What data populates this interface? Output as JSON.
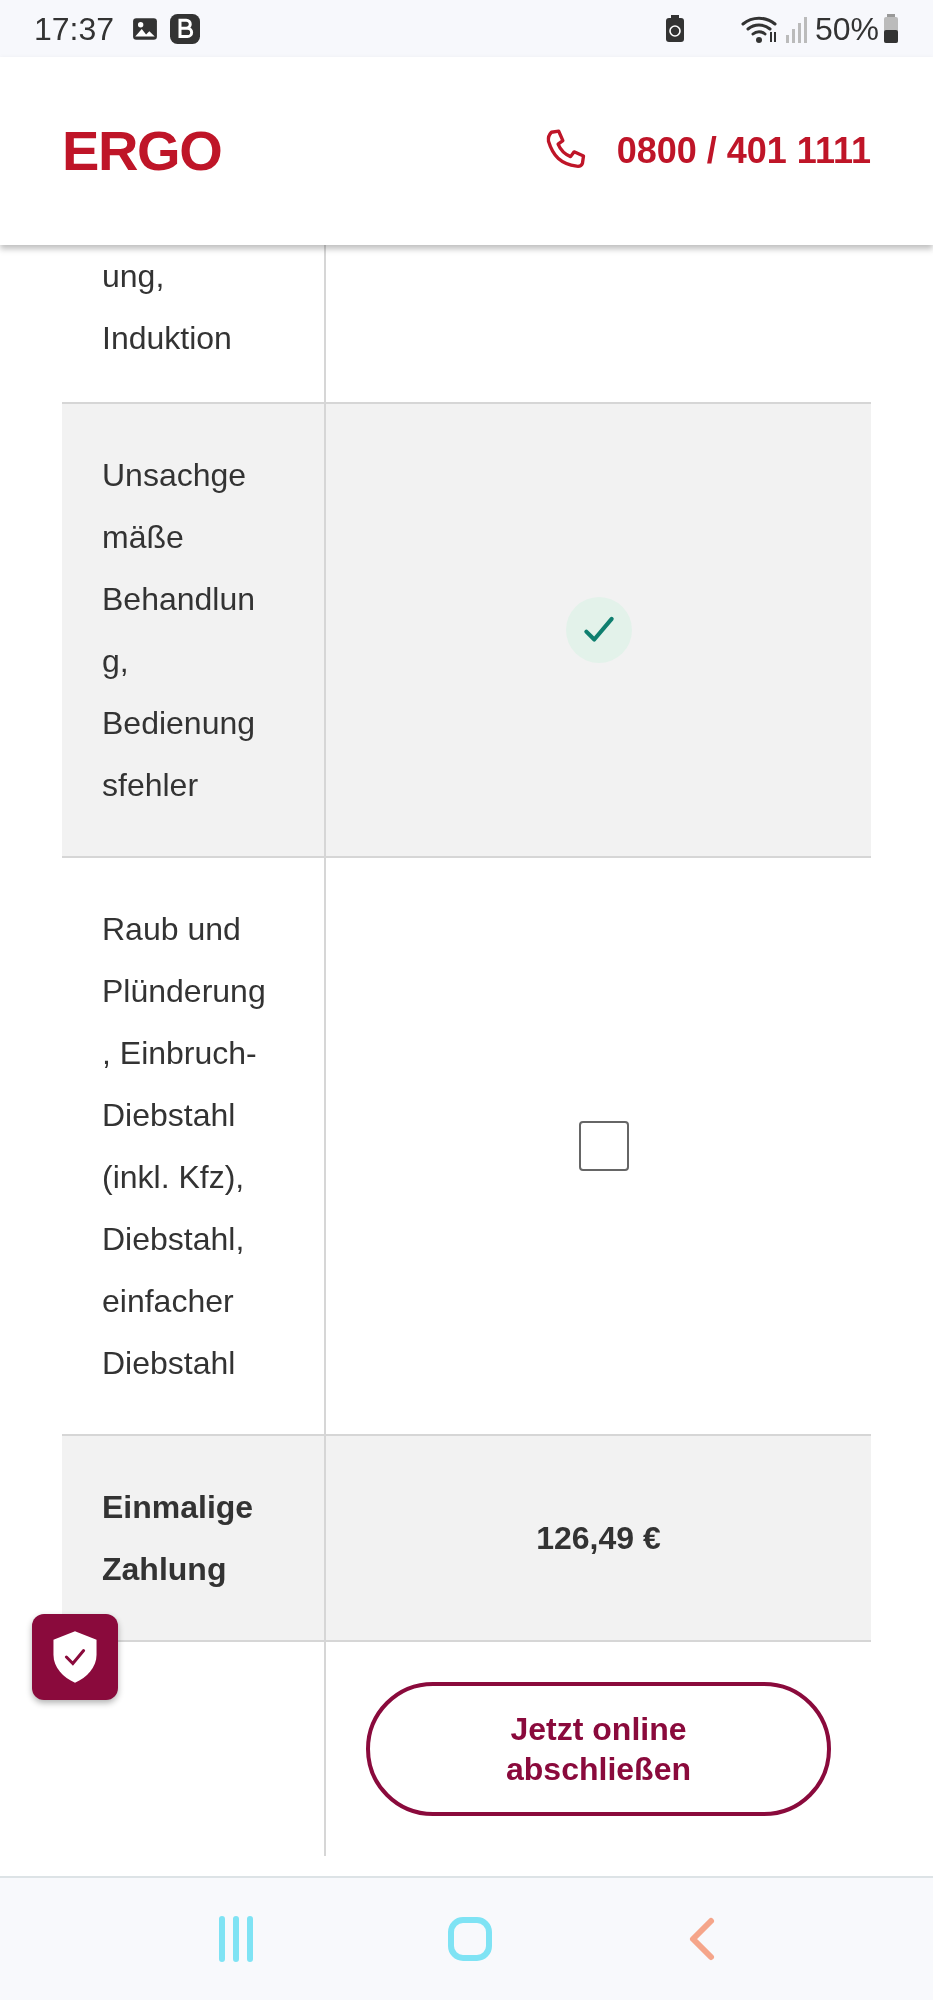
{
  "status_bar": {
    "time": "17:37",
    "battery": "50%"
  },
  "header": {
    "logo": "ERGO",
    "phone": "0800 / 401 1111"
  },
  "table": {
    "rows": [
      {
        "kind": "text",
        "lines": [
          "ung,",
          "Induktion"
        ],
        "shaded": false
      },
      {
        "kind": "check",
        "lines": [
          "Unsachge",
          "mäße",
          "Behandlun",
          "g,",
          "Bedienung",
          "sfehler"
        ],
        "shaded": true,
        "checked": true
      },
      {
        "kind": "check",
        "lines": [
          "Raub und",
          "Plünderung",
          ", Einbruch-",
          "Diebstahl",
          "(inkl. Kfz),",
          "Diebstahl,",
          "einfacher",
          "Diebstahl"
        ],
        "shaded": false,
        "checked": false
      },
      {
        "kind": "price",
        "lines": [
          "Einmalige",
          "Zahlung"
        ],
        "shaded": true,
        "value": "126,49 €"
      },
      {
        "kind": "action",
        "shaded": false,
        "button": "Jetzt online abschließen"
      }
    ]
  }
}
